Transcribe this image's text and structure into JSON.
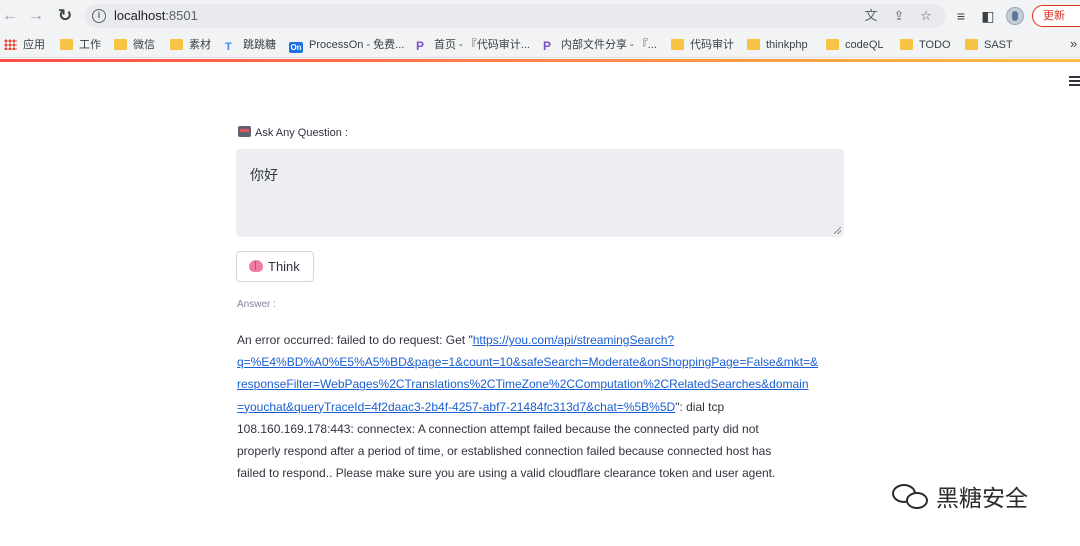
{
  "browser": {
    "url_host": "localhost",
    "url_port": ":8501",
    "update_label": "更新",
    "more_bookmarks": "»"
  },
  "bookmarks": [
    {
      "label": "应用",
      "icon": "apps-grid-icon"
    },
    {
      "label": "工作",
      "icon": "folder-icon"
    },
    {
      "label": "微信",
      "icon": "folder-icon"
    },
    {
      "label": "素材",
      "icon": "folder-icon"
    },
    {
      "label": "跳跳糖",
      "icon": "t-logo-icon"
    },
    {
      "label": "ProcessOn - 免费...",
      "icon": "processon-icon"
    },
    {
      "label": "首页 - 『代码审计...",
      "icon": "p-logo-icon"
    },
    {
      "label": "内部文件分享 - 『...",
      "icon": "p-logo-icon"
    },
    {
      "label": "代码审计",
      "icon": "folder-icon"
    },
    {
      "label": "thinkphp",
      "icon": "folder-icon"
    },
    {
      "label": "codeQL",
      "icon": "folder-icon"
    },
    {
      "label": "TODO",
      "icon": "folder-icon"
    },
    {
      "label": "SAST",
      "icon": "folder-icon"
    }
  ],
  "app": {
    "question_label": "Ask Any Question :",
    "question_value": "你好",
    "think_label": "Think",
    "answer_label": "Answer :",
    "answer": {
      "line1_prefix": "An error occurred: failed to do request: Get \"",
      "link_line1": "https://you.com/api/streamingSearch?",
      "link_line2": "q=%E4%BD%A0%E5%A5%BD&page=1&count=10&safeSearch=Moderate&onShoppingPage=False&mkt=&",
      "link_line3": "responseFilter=WebPages%2CTranslations%2CTimeZone%2CComputation%2CRelatedSearches&domain",
      "link_line4": "=youchat&queryTraceId=4f2daac3-2b4f-4257-abf7-21484fc313d7&chat=%5B%5D",
      "line4_suffix": "\": dial tcp",
      "line5": "108.160.169.178:443: connectex: A connection attempt failed because the connected party did not",
      "line6": "properly respond after a period of time, or established connection failed because connected host has",
      "line7": "failed to respond.. Please make sure you are using a valid cloudflare clearance token and user agent."
    }
  },
  "watermark": {
    "text": "黑糖安全"
  },
  "colors": {
    "accent": "#ff4b4b",
    "link": "#1a5fd1",
    "text": "#31333f",
    "input_bg": "#eceef1"
  }
}
